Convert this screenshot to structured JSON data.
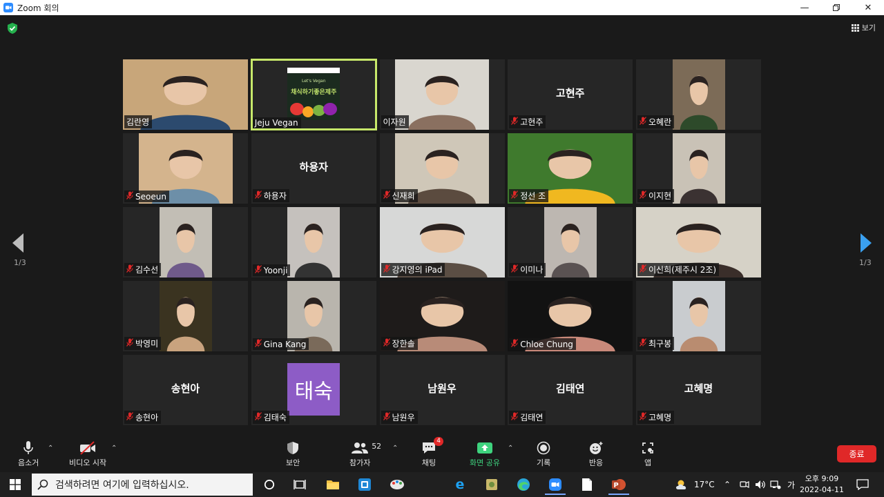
{
  "window": {
    "title": "Zoom 회의"
  },
  "meeting": {
    "view_label": "보기",
    "pager_left": "1/3",
    "pager_right": "1/3",
    "tiles": [
      {
        "name": "김란영",
        "type": "video",
        "bg": "#c8a67a",
        "fg": "#2c4a6e",
        "muted": false
      },
      {
        "name": "Jeju Vegan",
        "type": "logo",
        "active": true,
        "muted": false,
        "logo_text": "채식하기좋은제주",
        "logo_sub": "Let's Vegan"
      },
      {
        "name": "이자원",
        "type": "video-center-wide",
        "bg": "#d9d6cf",
        "fg": "#8a7060",
        "muted": false
      },
      {
        "name": "고현주",
        "type": "name",
        "muted": true
      },
      {
        "name": "오혜란",
        "type": "video-center",
        "bg": "#7c6b57",
        "fg": "#2d4a2a",
        "muted": true
      },
      {
        "name": "Seoeun",
        "type": "video-center-wide",
        "bg": "#d4b48d",
        "fg": "#6d8fa8",
        "muted": true
      },
      {
        "name": "하용자",
        "type": "name",
        "muted": true
      },
      {
        "name": "신재희",
        "type": "video-center-wide",
        "bg": "#cfc7b8",
        "fg": "#5b4b3f",
        "muted": true
      },
      {
        "name": "정선 조",
        "type": "video",
        "bg": "#3f7a2d",
        "fg": "#f0b820",
        "muted": true
      },
      {
        "name": "이지현",
        "type": "video-center",
        "bg": "#c9c2b6",
        "fg": "#3b3232",
        "muted": true
      },
      {
        "name": "김수선",
        "type": "video-center",
        "bg": "#c2beb5",
        "fg": "#6f5a8a",
        "muted": true
      },
      {
        "name": "Yoonji",
        "type": "video-center",
        "bg": "#c5c1bd",
        "fg": "#333333",
        "muted": true
      },
      {
        "name": "강지영의 iPad",
        "type": "video",
        "bg": "#d7d8d7",
        "fg": "#5b4e44",
        "muted": true
      },
      {
        "name": "이미나",
        "type": "video-center",
        "bg": "#bdb7b1",
        "fg": "#5a5252",
        "muted": true
      },
      {
        "name": "이신희(제주시 2조)",
        "type": "video",
        "bg": "#d6d2c7",
        "fg": "#3a2e2a",
        "muted": true
      },
      {
        "name": "박영미",
        "type": "video-center",
        "bg": "#3a3320",
        "fg": "#c9a37e",
        "muted": true
      },
      {
        "name": "Gina Kang",
        "type": "video-center",
        "bg": "#b9b5ad",
        "fg": "#7a6a5a",
        "muted": true
      },
      {
        "name": "장한솔",
        "type": "video",
        "bg": "#1e1b1a",
        "fg": "#b88b78",
        "muted": true
      },
      {
        "name": "Chloe Chung",
        "type": "video",
        "bg": "#121212",
        "fg": "#c9897a",
        "muted": true
      },
      {
        "name": "최구봉",
        "type": "video-center",
        "bg": "#c9cccf",
        "fg": "#b98c70",
        "muted": true
      },
      {
        "name": "송현아",
        "type": "name",
        "muted": true
      },
      {
        "name": "김태숙",
        "type": "avatar",
        "avatar_text": "태숙",
        "muted": true
      },
      {
        "name": "남원우",
        "type": "name",
        "muted": true
      },
      {
        "name": "김태연",
        "type": "name",
        "muted": true
      },
      {
        "name": "고혜명",
        "type": "name",
        "muted": true
      }
    ]
  },
  "toolbar": {
    "mute_label": "음소거",
    "video_label": "비디오 시작",
    "security_label": "보안",
    "participants_label": "참가자",
    "participants_count": "52",
    "chat_label": "채팅",
    "chat_badge": "4",
    "share_label": "화면 공유",
    "record_label": "기록",
    "reactions_label": "반응",
    "apps_label": "앱",
    "end_label": "종료"
  },
  "taskbar": {
    "search_placeholder": "검색하려면 여기에 입력하십시오.",
    "temperature": "17°C",
    "ime": "가",
    "time": "오후 9:09",
    "date": "2022-04-11"
  },
  "colors": {
    "accent_green": "#3ed37e",
    "end_red": "#e02828",
    "active_border": "#c7e86a",
    "avatar_purple": "#8d5cc6",
    "nav_blue": "#3aa0f0"
  }
}
